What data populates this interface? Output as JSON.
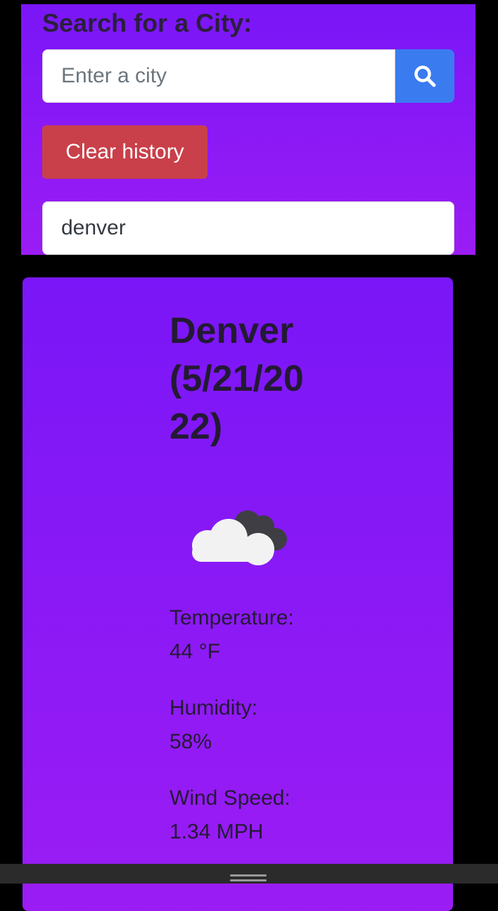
{
  "search": {
    "heading": "Search for a City:",
    "placeholder": "Enter a city",
    "search_button_icon": "search-icon",
    "clear_button_label": "Clear history"
  },
  "history": [
    {
      "city": "denver"
    }
  ],
  "weather": {
    "title": "Denver (5/21/2022)",
    "icon": "cloud-icon",
    "temperature_label": "Temperature:",
    "temperature_value": "44 °F",
    "humidity_label": "Humidity:",
    "humidity_value": "58%",
    "wind_label": "Wind Speed:",
    "wind_value": "1.34 MPH"
  },
  "colors": {
    "panel_gradient_top": "#7a16f7",
    "panel_gradient_bottom": "#9b1cf4",
    "search_button": "#3a7bf0",
    "clear_button": "#c9404a",
    "page_background": "#000000"
  }
}
